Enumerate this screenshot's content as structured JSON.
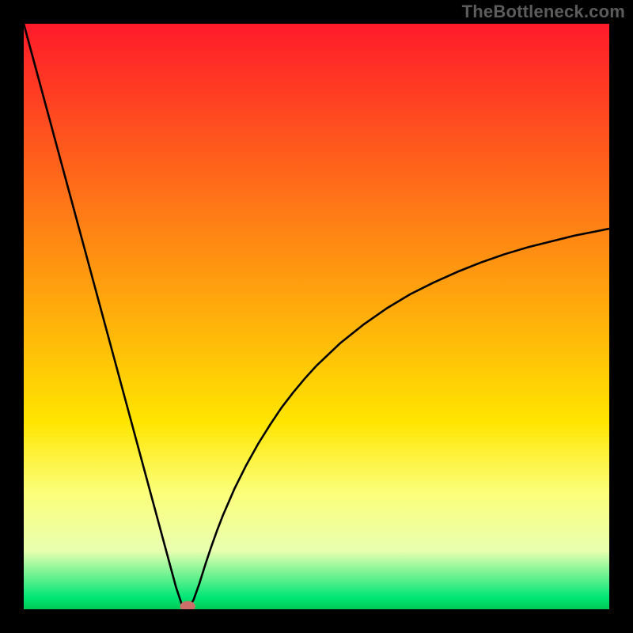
{
  "watermark": "TheBottleneck.com",
  "chart_data": {
    "type": "line",
    "title": "",
    "xlabel": "",
    "ylabel": "",
    "xlim": [
      0,
      100
    ],
    "ylim": [
      0,
      100
    ],
    "grid": false,
    "legend": false,
    "x": [
      0,
      2,
      4,
      6,
      8,
      10,
      12,
      14,
      16,
      18,
      20,
      22,
      24,
      26,
      27,
      28,
      29,
      30,
      31,
      32,
      33,
      34,
      36,
      38,
      40,
      42,
      44,
      46,
      48,
      50,
      54,
      58,
      62,
      66,
      70,
      74,
      78,
      82,
      86,
      90,
      94,
      98,
      100
    ],
    "values": [
      100,
      92.6,
      85.2,
      77.8,
      70.4,
      63.0,
      55.6,
      48.2,
      40.8,
      33.4,
      26.0,
      18.6,
      11.2,
      3.8,
      0.8,
      0.0,
      1.6,
      4.4,
      7.6,
      10.6,
      13.4,
      16.0,
      20.6,
      24.6,
      28.2,
      31.4,
      34.4,
      37.0,
      39.4,
      41.6,
      45.4,
      48.6,
      51.4,
      53.8,
      55.8,
      57.6,
      59.2,
      60.6,
      61.8,
      62.8,
      63.8,
      64.6,
      65.0
    ],
    "optimum_x": 28,
    "optimum_y": 0,
    "marker_color": "#cc6f6a",
    "curve_color": "#000000",
    "gradient_stops": [
      {
        "offset": "0%",
        "color": "#ff1a2a"
      },
      {
        "offset": "68%",
        "color": "#ffe500"
      },
      {
        "offset": "80%",
        "color": "#fcff7a"
      },
      {
        "offset": "90%",
        "color": "#e9ffb0"
      },
      {
        "offset": "98%",
        "color": "#00e676"
      },
      {
        "offset": "100%",
        "color": "#00c853"
      }
    ]
  }
}
